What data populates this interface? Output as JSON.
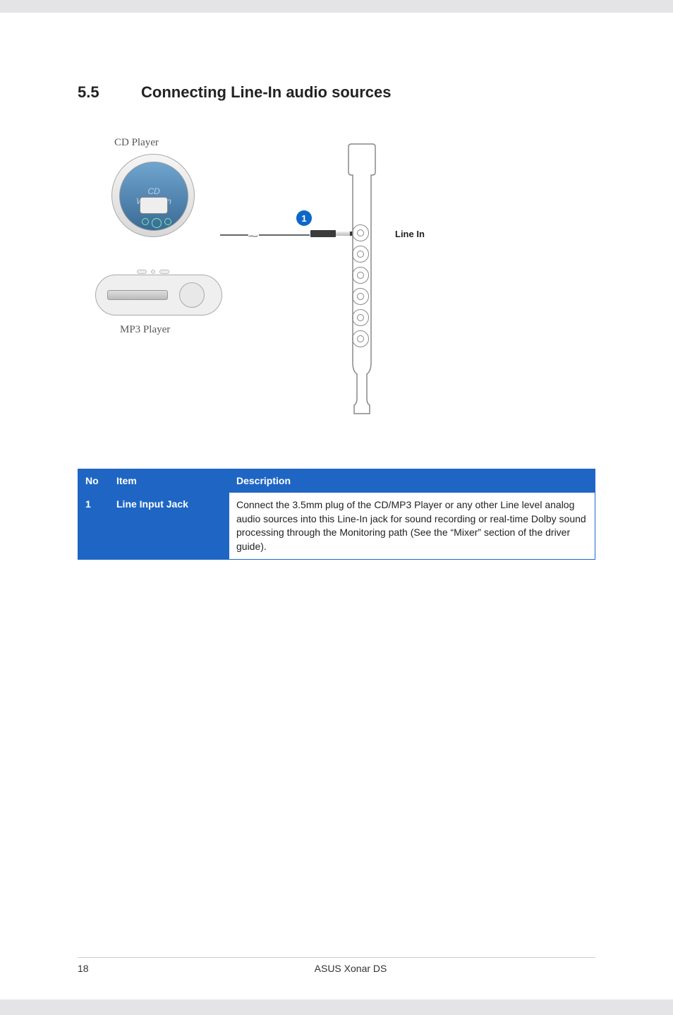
{
  "heading": {
    "num": "5.5",
    "title": "Connecting Line-In audio sources"
  },
  "diagram": {
    "cd_label": "CD Player",
    "cd_text1": "CD",
    "cd_text2": "Walkman",
    "mp3_label": "MP3 Player",
    "badge": "1",
    "linein_label": "Line In"
  },
  "table": {
    "headers": {
      "no": "No",
      "item": "Item",
      "desc": "Description"
    },
    "rows": [
      {
        "no": "1",
        "item": "Line Input Jack",
        "desc": "Connect the 3.5mm plug of the CD/MP3 Player or any other Line level analog audio sources into this Line-In jack for sound recording or real-time Dolby sound processing through the Monitoring path (See the “Mixer” section of the driver guide)."
      }
    ]
  },
  "footer": {
    "page": "18",
    "book": "ASUS Xonar DS"
  }
}
